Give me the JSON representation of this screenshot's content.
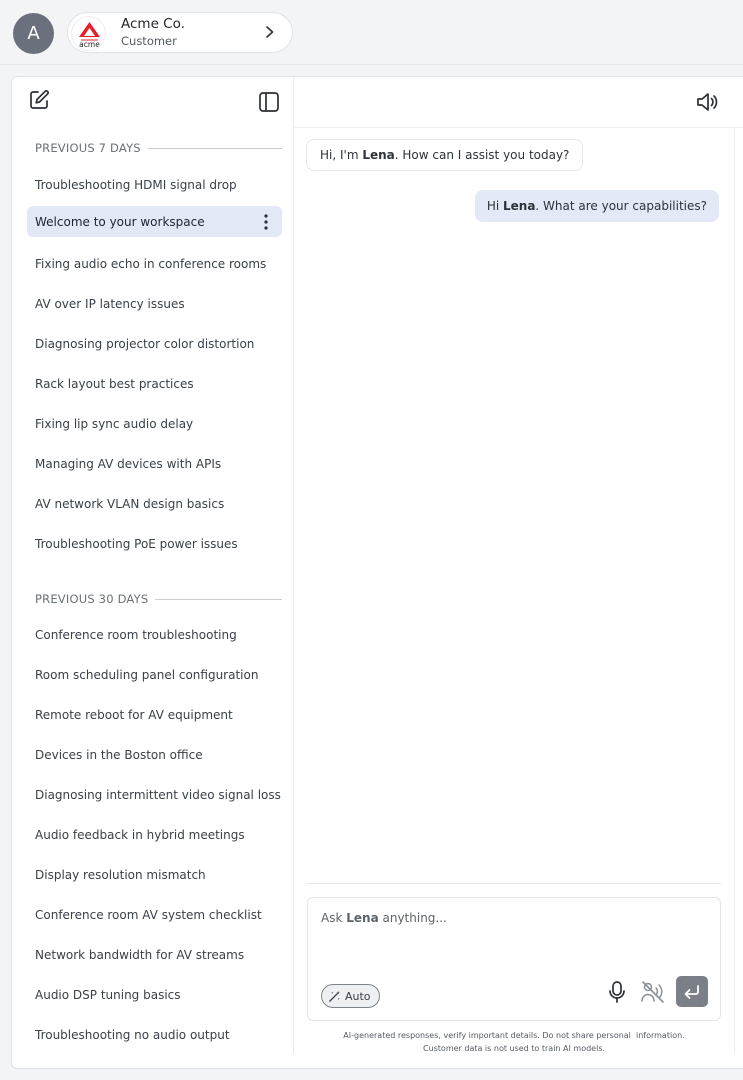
{
  "user": {
    "avatar_initial": "A"
  },
  "org": {
    "name": "Acme Co.",
    "role": "Customer",
    "logo_text": "acme"
  },
  "sidebar": {
    "section_7": "PREVIOUS 7 DAYS",
    "items_7": [
      "Troubleshooting HDMI signal drop",
      "Welcome to your workspace",
      "Fixing audio echo in conference rooms",
      "AV over IP latency issues",
      "Diagnosing projector color distortion",
      "Rack layout best practices",
      "Fixing lip sync audio delay",
      "Managing AV devices with APIs",
      "AV network VLAN design basics",
      "Troubleshooting PoE power issues"
    ],
    "section_30": "PREVIOUS 30 DAYS",
    "items_30": [
      "Conference room troubleshooting",
      "Room scheduling panel configuration",
      "Remote reboot for AV equipment",
      "Devices in the Boston office",
      "Diagnosing intermittent video signal loss",
      "Audio feedback in hybrid meetings",
      "Display resolution mismatch",
      "Conference room AV system checklist",
      "Network bandwidth for AV streams",
      "Audio DSP tuning basics",
      "Troubleshooting no audio output"
    ]
  },
  "chat": {
    "assistant_name": "Lena",
    "bot_prefix": "Hi, I'm ",
    "bot_suffix": ". How can I assist you today?",
    "user_prefix": "Hi ",
    "user_suffix": ". What are your capabilities?"
  },
  "composer": {
    "ph_prefix": "Ask ",
    "ph_suffix": " anything...",
    "mode_label": "Auto"
  },
  "disclaimer": {
    "line1": "AI-generated responses, verify important details. Do not share personal  information.",
    "line2": "Customer data is not used to train AI models."
  },
  "colors": {
    "active_item": "#e2e8f5",
    "user_bubble": "#e3e9f6",
    "send_button": "#7b8088",
    "brand_red": "#e4202a"
  }
}
